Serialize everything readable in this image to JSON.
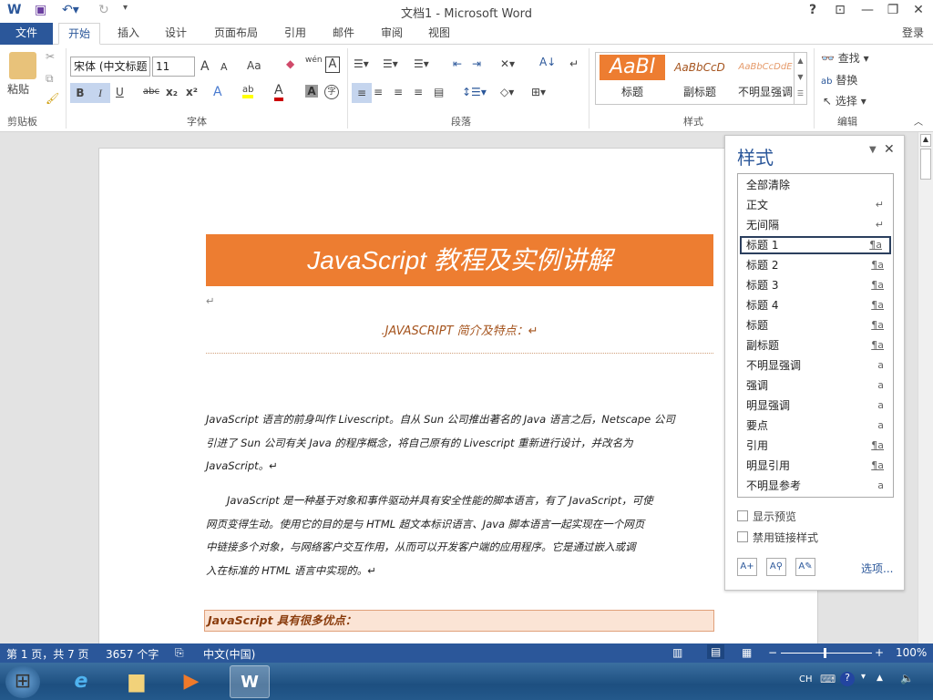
{
  "window": {
    "title": "文档1 - Microsoft Word",
    "help": "?",
    "login": "登录"
  },
  "tabs": [
    {
      "label": "文件"
    },
    {
      "label": "开始"
    },
    {
      "label": "插入"
    },
    {
      "label": "设计"
    },
    {
      "label": "页面布局"
    },
    {
      "label": "引用"
    },
    {
      "label": "邮件"
    },
    {
      "label": "审阅"
    },
    {
      "label": "视图"
    }
  ],
  "ribbon": {
    "clipboard": {
      "paste": "粘贴",
      "label": "剪贴板"
    },
    "font": {
      "name": "宋体 (中文标题",
      "size": "11",
      "label": "字体",
      "grow": "A",
      "shrink": "A",
      "case": "Aa",
      "phonetic": "wén",
      "border_char": "A",
      "bold": "B",
      "italic": "I",
      "underline": "U",
      "strike": "abc",
      "sub": "x₂",
      "sup": "x²",
      "effects": "A",
      "highlight": "ab",
      "color": "A",
      "shading": "A",
      "enclose": "字"
    },
    "paragraph": {
      "label": "段落"
    },
    "styles": {
      "label": "样式",
      "items": [
        {
          "preview": "AaBl",
          "name": "标题"
        },
        {
          "preview": "AaBbCcD",
          "name": "副标题"
        },
        {
          "preview": "AaBbCcDdE",
          "name": "不明显强调"
        }
      ]
    },
    "editing": {
      "label": "编辑",
      "find": "查找",
      "replace": "替换",
      "select": "选择"
    }
  },
  "document": {
    "title": "JavaScript 教程及实例讲解",
    "subtitle": ".JAVASCRIPT 简介及特点：↵",
    "para1": [
      "JavaScript 语言的前身叫作 Livescript。自从 Sun 公司推出著名的 Java 语言之后，Netscape 公司",
      "引进了 Sun 公司有关 Java 的程序概念，将自己原有的 Livescript 重新进行设计，并改名为",
      "JavaScript。↵"
    ],
    "para2": [
      "　　JavaScript 是一种基于对象和事件驱动并具有安全性能的脚本语言，有了 JavaScript，可使",
      "网页变得生动。使用它的目的是与 HTML 超文本标识语言、Java 脚本语言一起实现在一个网页",
      "中链接多个对象，与网络客户交互作用，从而可以开发客户端的应用程序。它是通过嵌入或调",
      "入在标准的 HTML 语言中实现的。↵"
    ],
    "heading2": "JavaScript 具有很多优点：",
    "empty_mark": "↵"
  },
  "styles_pane": {
    "title": "样式",
    "items": [
      {
        "name": "全部清除",
        "icon": ""
      },
      {
        "name": "正文",
        "icon": "↵"
      },
      {
        "name": "无间隔",
        "icon": "↵"
      },
      {
        "name": "标题 1",
        "icon": "¶a"
      },
      {
        "name": "标题 2",
        "icon": "¶a"
      },
      {
        "name": "标题 3",
        "icon": "¶a"
      },
      {
        "name": "标题 4",
        "icon": "¶a"
      },
      {
        "name": "标题",
        "icon": "¶a"
      },
      {
        "name": "副标题",
        "icon": "¶a"
      },
      {
        "name": "不明显强调",
        "icon": "a"
      },
      {
        "name": "强调",
        "icon": "a"
      },
      {
        "name": "明显强调",
        "icon": "a"
      },
      {
        "name": "要点",
        "icon": "a"
      },
      {
        "name": "引用",
        "icon": "¶a"
      },
      {
        "name": "明显引用",
        "icon": "¶a"
      },
      {
        "name": "不明显参考",
        "icon": "a"
      }
    ],
    "selected": "标题 1",
    "show_preview": "显示预览",
    "disable_linked": "禁用链接样式",
    "options": "选项..."
  },
  "status": {
    "page": "第 1 页，共 7 页",
    "words": "3657 个字",
    "lang": "中文(中国)",
    "zoom": "100%"
  },
  "taskbar": {
    "ime": "CH"
  },
  "colors": {
    "accent": "#2b579a",
    "banner": "#ed7d31"
  }
}
